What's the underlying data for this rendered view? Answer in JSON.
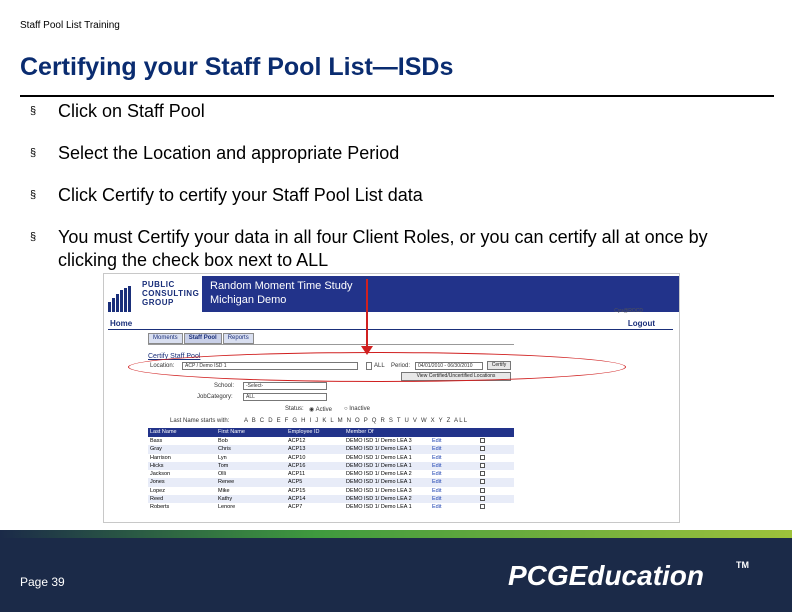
{
  "header": {
    "small_title": "Staff Pool List Training"
  },
  "slide": {
    "title": "Certifying your Staff Pool List—ISDs"
  },
  "bullets": [
    {
      "mark": "§",
      "text": "Click on Staff Pool"
    },
    {
      "mark": "§",
      "text": "Select the Location and appropriate Period"
    },
    {
      "mark": "§",
      "text": "Click Certify to certify your Staff Pool List data"
    },
    {
      "mark": "§",
      "text": "You must Certify your data in all four Client Roles, or you can certify all at once by clicking the check box next to ALL"
    }
  ],
  "screenshot": {
    "logo_lines": [
      "PUBLIC",
      "CONSULTING",
      "GROUP"
    ],
    "app_title": "Random Moment Time Study",
    "app_subtitle": "Michigan Demo",
    "user": "Cyu@ROCD",
    "home": "Home",
    "logout": "Logout",
    "tabs": [
      "Moments",
      "Staff Pool",
      "Reports"
    ],
    "certify_heading": "Certify Staff Pool",
    "location_label": "Location:",
    "location_value": "ACP / Demo ISD 1",
    "all_label": "ALL",
    "period_label": "Period:",
    "period_value": "04/01/2010 - 06/30/2010",
    "certify_button": "Certify",
    "view_button": "View Certified/Uncertified Locations",
    "school_label": "School:",
    "school_value": "-Select-",
    "jobcategory_label": "JobCategory:",
    "jobcategory_value": "ALL",
    "status_label": "Status:",
    "status_active": "Active",
    "status_inactive": "Inactive",
    "lastname_label": "Last Name starts with:",
    "letters": "A B C D E F G H I J K L M N O P Q R S T U V W X Y Z ALL",
    "columns": [
      "Last Name",
      "First Name",
      "Employee ID",
      "Member Of",
      "",
      ""
    ],
    "rows": [
      [
        "Bass",
        "Bob",
        "ACP12",
        "DEMO ISD 1/ Demo LEA 3",
        "Edit"
      ],
      [
        "Gray",
        "Chris",
        "ACP13",
        "DEMO ISD 1/ Demo LEA 1",
        "Edit"
      ],
      [
        "Harrison",
        "Lyn",
        "ACP10",
        "DEMO ISD 1/ Demo LEA 1",
        "Edit"
      ],
      [
        "Hicks",
        "Tom",
        "ACP16",
        "DEMO ISD 1/ Demo LEA 1",
        "Edit"
      ],
      [
        "Jackson",
        "Olli",
        "ACP11",
        "DEMO ISD 1/ Demo LEA 2",
        "Edit"
      ],
      [
        "Jones",
        "Renee",
        "ACP5",
        "DEMO ISD 1/ Demo LEA 1",
        "Edit"
      ],
      [
        "Lopez",
        "Mike",
        "ACP15",
        "DEMO ISD 1/ Demo LEA 3",
        "Edit"
      ],
      [
        "Reed",
        "Kathy",
        "ACP14",
        "DEMO ISD 1/ Demo LEA 2",
        "Edit"
      ],
      [
        "Roberts",
        "Lenore",
        "ACP7",
        "DEMO ISD 1/ Demo LEA 1",
        "Edit"
      ]
    ]
  },
  "footer": {
    "page": "Page 39",
    "brand": "PCGEducation",
    "brand_tm": "TM"
  },
  "colors": {
    "title": "#0a2c70",
    "annotation": "#d02020",
    "footer_bg": "#1b2a48",
    "app_blue": "#22338a"
  }
}
